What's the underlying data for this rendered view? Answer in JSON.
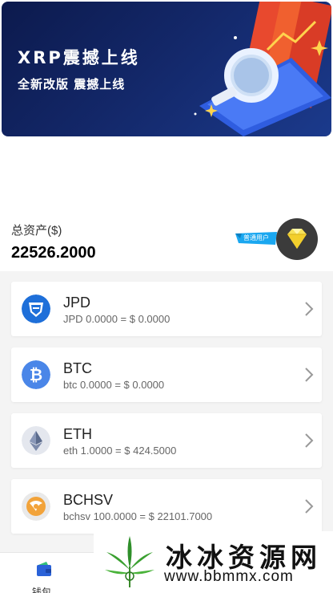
{
  "banner": {
    "title": "XRP震撼上线",
    "subtitle": "全新改版  震撼上线"
  },
  "account": {
    "total_label": "总资产($)",
    "total_value": "22526.2000",
    "user_level": "普通用户"
  },
  "assets": [
    {
      "name": "JPD",
      "detail": "JPD 0.0000 = $ 0.0000",
      "icon": "jpd-shield-icon"
    },
    {
      "name": "BTC",
      "detail": "btc 0.0000 = $ 0.0000",
      "icon": "bitcoin-icon"
    },
    {
      "name": "ETH",
      "detail": "eth 1.0000 = $ 424.5000",
      "icon": "ethereum-icon"
    },
    {
      "name": "BCHSV",
      "detail": "bchsv 100.0000 = $ 22101.7000",
      "icon": "bchsv-icon"
    }
  ],
  "nav": {
    "wallet_label": "钱包"
  },
  "watermark": {
    "text": "冰冰资源网",
    "url": "www.bbmmx.com"
  },
  "colors": {
    "banner_bg": "#132768",
    "btc": "#4a86e8",
    "jpd": "#1e6fd9",
    "tag_blue": "#1aa7f0",
    "diamond": "#f7e25a"
  }
}
